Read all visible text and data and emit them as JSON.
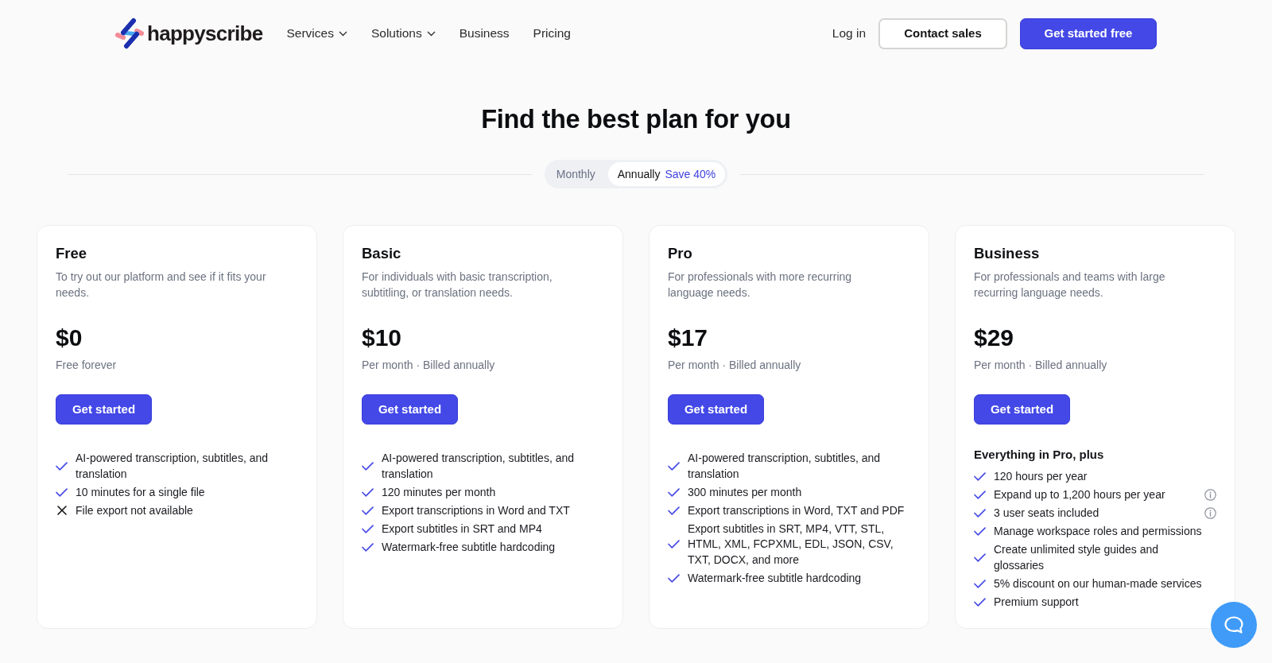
{
  "nav": {
    "brand": "happyscribe",
    "links": [
      {
        "label": "Services",
        "dropdown": true
      },
      {
        "label": "Solutions",
        "dropdown": true
      },
      {
        "label": "Business",
        "dropdown": false
      },
      {
        "label": "Pricing",
        "dropdown": false
      }
    ],
    "login": "Log in",
    "contact_button": "Contact sales",
    "cta_button": "Get started free"
  },
  "heading": "Find the best plan for you",
  "billing_toggle": {
    "options": [
      {
        "label": "Monthly",
        "selected": false
      },
      {
        "label": "Annually",
        "selected": true,
        "badge": "Save 40%"
      }
    ]
  },
  "plans": [
    {
      "name": "Free",
      "description": "To try out our platform and see if it fits your needs.",
      "price": "$0",
      "billing": "Free forever",
      "button": "Get started",
      "features": [
        {
          "text": "AI-powered transcription, subtitles, and translation",
          "included": true
        },
        {
          "text": "10 minutes for a single file",
          "included": true
        },
        {
          "text": "File export not available",
          "included": false
        }
      ]
    },
    {
      "name": "Basic",
      "description": "For individuals with basic transcription, subtitling, or translation needs.",
      "price": "$10",
      "billing": "Per month · Billed annually",
      "button": "Get started",
      "features": [
        {
          "text": "AI-powered transcription, subtitles, and translation",
          "included": true
        },
        {
          "text": "120 minutes per month",
          "included": true
        },
        {
          "text": "Export transcriptions in Word and TXT",
          "included": true
        },
        {
          "text": "Export subtitles in SRT and MP4",
          "included": true
        },
        {
          "text": "Watermark-free subtitle hardcoding",
          "included": true
        }
      ]
    },
    {
      "name": "Pro",
      "description": "For professionals with more recurring language needs.",
      "price": "$17",
      "billing": "Per month · Billed annually",
      "button": "Get started",
      "features": [
        {
          "text": "AI-powered transcription, subtitles, and translation",
          "included": true
        },
        {
          "text": "300 minutes per month",
          "included": true
        },
        {
          "text": "Export transcriptions in Word, TXT and PDF",
          "included": true
        },
        {
          "text": "Export subtitles in SRT, MP4, VTT, STL, HTML, XML, FCPXML, EDL, JSON, CSV, TXT, DOCX, and more",
          "included": true
        },
        {
          "text": "Watermark-free subtitle hardcoding",
          "included": true
        }
      ]
    },
    {
      "name": "Business",
      "description": "For professionals and teams with large recurring language needs.",
      "price": "$29",
      "billing": "Per month · Billed annually",
      "button": "Get started",
      "features_heading": "Everything in Pro, plus",
      "features": [
        {
          "text": "120 hours per year",
          "included": true,
          "info": false
        },
        {
          "text": "Expand up to 1,200 hours per year",
          "included": true,
          "info": true
        },
        {
          "text": "3 user seats included",
          "included": true,
          "info": true
        },
        {
          "text": "Manage workspace roles and permissions",
          "included": true,
          "info": false
        },
        {
          "text": "Create unlimited style guides and glossaries",
          "included": true,
          "info": false
        },
        {
          "text": "5% discount on our human-made services",
          "included": true,
          "info": false
        },
        {
          "text": "Premium support",
          "included": true,
          "info": false
        }
      ]
    }
  ]
}
